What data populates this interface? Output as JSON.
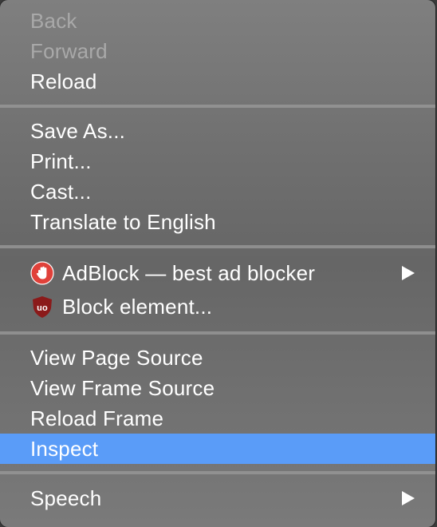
{
  "menu": {
    "back": "Back",
    "forward": "Forward",
    "reload": "Reload",
    "save_as": "Save As...",
    "print": "Print...",
    "cast": "Cast...",
    "translate": "Translate to English",
    "adblock": "AdBlock — best ad blocker",
    "block_element": "Block element...",
    "view_page_source": "View Page Source",
    "view_frame_source": "View Frame Source",
    "reload_frame": "Reload Frame",
    "inspect": "Inspect",
    "speech": "Speech"
  },
  "icons": {
    "adblock": "adblock-hand-icon",
    "ublock": "ublock-origin-icon",
    "submenu": "chevron-right-icon"
  },
  "colors": {
    "highlight": "#5a9cf8",
    "disabled_text": "#a9a9a9",
    "text": "#ffffff",
    "adblock_red": "#e0413a",
    "ublock_red": "#8b1a1a"
  },
  "state": {
    "highlighted_item": "Inspect",
    "disabled_items": [
      "Back",
      "Forward"
    ]
  }
}
